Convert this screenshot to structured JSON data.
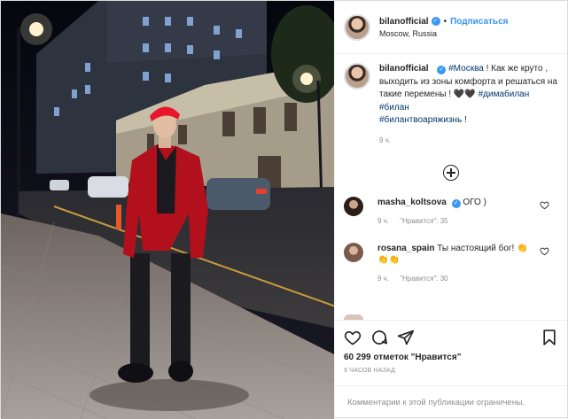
{
  "header": {
    "username": "bilanofficial",
    "separator": "•",
    "follow_label": "Подписаться",
    "location": "Moscow, Russia"
  },
  "caption": {
    "username": "bilanofficial",
    "tag_moscow": "#Москва",
    "text_1": "! Как же круто , выходить из зоны комфорта и решаться на такие перемены ! 🖤🖤",
    "tag_1": "#димабилан",
    "tag_2": "#билан",
    "tag_3": "#билантвоаряжизнь",
    "text_end": "!",
    "age": "9 ч."
  },
  "comments": [
    {
      "username": "masha_koltsova",
      "text": "ОГО )",
      "age": "9 ч.",
      "likes": "\"Нравится\": 35"
    },
    {
      "username": "rosana_spain",
      "text": "Ты настоящий бог! 👏👏👏",
      "age": "9 ч.",
      "likes": "\"Нравится\": 30"
    }
  ],
  "footer": {
    "likes": "60 299 отметок \"Нравится\"",
    "time": "9 ЧАСОВ НАЗАД",
    "comments_disabled": "Комментарии к этой публикации ограничены."
  },
  "icons": {
    "verified": "verified-badge-icon",
    "like": "heart-icon",
    "comment": "comment-icon",
    "share": "share-icon",
    "save": "bookmark-icon",
    "load_more": "plus-circle-icon"
  },
  "colors": {
    "accent": "#3897f0",
    "hashtag": "#00376b",
    "muted": "#8e8e8e"
  }
}
